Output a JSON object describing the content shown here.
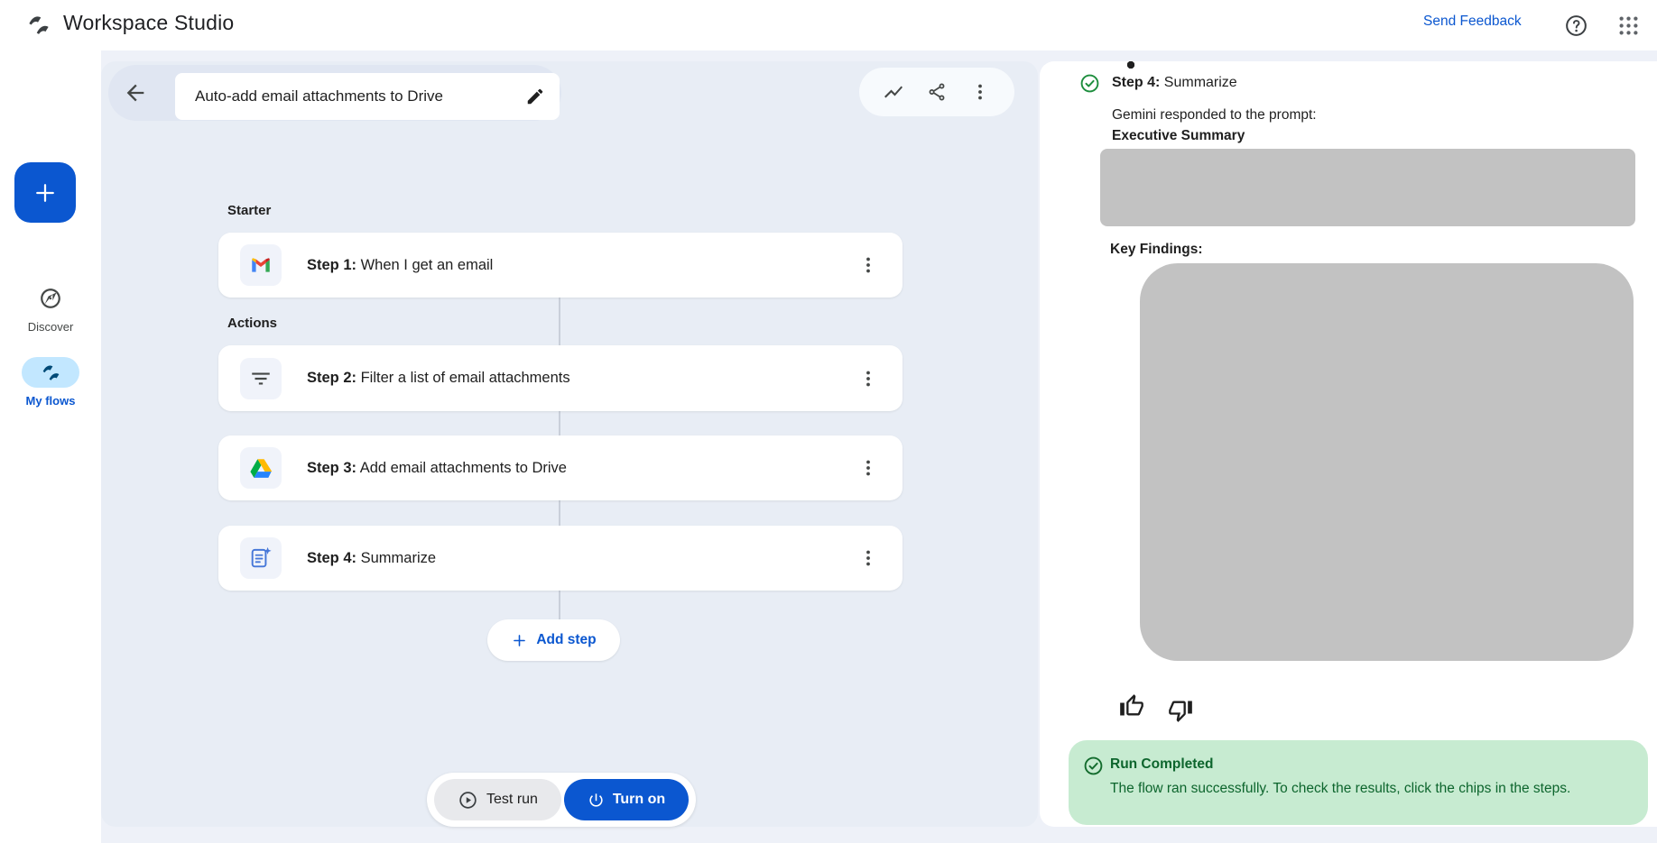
{
  "header": {
    "app_title": "Workspace Studio",
    "send_feedback_label": "Send Feedback"
  },
  "sidebar": {
    "discover_label": "Discover",
    "my_flows_label": "My flows"
  },
  "canvas": {
    "flow_title": "Auto-add email attachments to Drive",
    "starter_section_label": "Starter",
    "actions_section_label": "Actions",
    "steps": [
      {
        "prefix": "Step 1:",
        "label": " When I get an email",
        "icon": "gmail-icon"
      },
      {
        "prefix": "Step 2:",
        "label": " Filter a list of email attachments",
        "icon": "filter-list-icon"
      },
      {
        "prefix": "Step 3:",
        "label": " Add email attachments to Drive",
        "icon": "google-drive-icon"
      },
      {
        "prefix": "Step 4:",
        "label": " Summarize",
        "icon": "summarize-gemini-icon"
      }
    ],
    "add_step_label": "Add step",
    "test_run_label": "Test run",
    "turn_on_label": "Turn on"
  },
  "results_panel": {
    "step_header_prefix": "Step 4:",
    "step_header_label": " Summarize",
    "response_intro": "Gemini responded to the prompt:",
    "prompt_title": "Executive Summary",
    "key_findings_label": "Key Findings:",
    "redacted_bullet_count": 5,
    "toast": {
      "title": "Run Completed",
      "message": "The flow ran successfully. To check the results, click the chips in the steps."
    }
  },
  "colors": {
    "accent_blue": "#0b57d0",
    "canvas_bg": "#e8edf5",
    "selected_nav_pill": "#c2e7ff",
    "toast_bg": "#c7ebd1",
    "toast_text": "#0d652d",
    "redacted_gray": "#c2c2c2"
  }
}
